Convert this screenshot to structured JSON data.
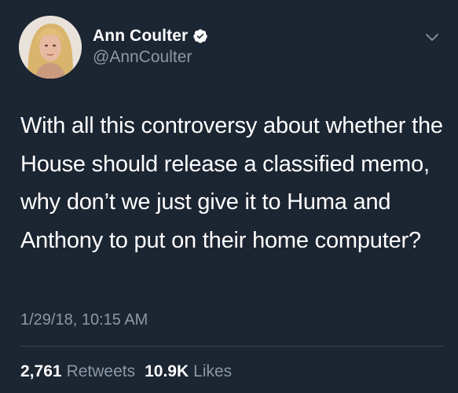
{
  "tweet": {
    "author": {
      "display_name": "Ann Coulter",
      "handle": "@AnnCoulter",
      "verified": true
    },
    "text": "With all this controversy about whether the House should release a classified memo, why don’t we just give it to Huma and Anthony to put on their home computer?",
    "timestamp": "1/29/18, 10:15 AM",
    "stats": {
      "retweets_count": "2,761",
      "retweets_label": "Retweets",
      "likes_count": "10.9K",
      "likes_label": "Likes"
    }
  },
  "icons": {
    "verified": "verified-badge-icon",
    "menu": "chevron-down-icon"
  },
  "colors": {
    "background": "#1c2532",
    "primary_text": "#ffffff",
    "secondary_text": "#8b98a5",
    "divider": "#38444d"
  }
}
